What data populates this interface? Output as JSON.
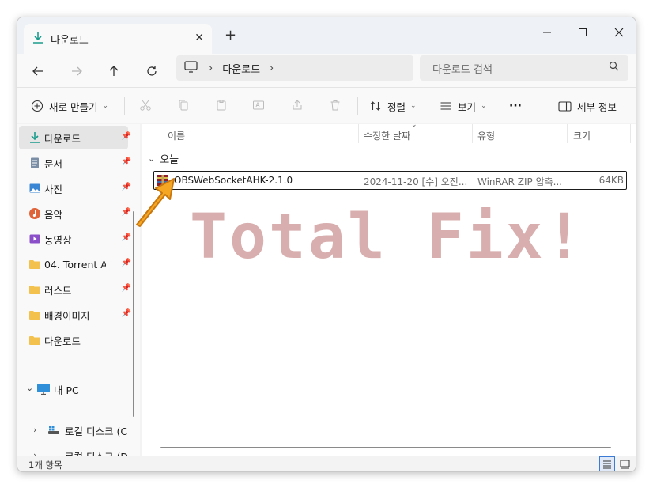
{
  "window": {
    "tab_title": "다운로드",
    "tab_close": "✕",
    "new_tab": "+"
  },
  "address_bar": {
    "breadcrumb": "다운로드",
    "search_placeholder": "다운로드 검색"
  },
  "command_bar": {
    "new_label": "새로 만들기",
    "sort_label": "정렬",
    "view_label": "보기",
    "more_label": "···",
    "details_label": "세부 정보"
  },
  "sidebar": {
    "items": [
      {
        "label": "다운로드",
        "icon": "download-icon",
        "pinned": true
      },
      {
        "label": "문서",
        "icon": "document-icon",
        "pinned": true
      },
      {
        "label": "사진",
        "icon": "picture-icon",
        "pinned": true
      },
      {
        "label": "음악",
        "icon": "music-icon",
        "pinned": true
      },
      {
        "label": "동영상",
        "icon": "video-icon",
        "pinned": true
      },
      {
        "label": "04. Torrent A",
        "icon": "folder-icon",
        "pinned": true
      },
      {
        "label": "러스트",
        "icon": "folder-icon",
        "pinned": true
      },
      {
        "label": "배경이미지",
        "icon": "folder-icon",
        "pinned": true
      },
      {
        "label": "다운로드",
        "icon": "folder-icon",
        "pinned": false
      }
    ],
    "this_pc": "내 PC",
    "drives": [
      "로컬 디스크 (C",
      "로컬 디스크 (D"
    ]
  },
  "columns": {
    "name": "이름",
    "modified": "수정한 날짜",
    "type": "유형",
    "size": "크기"
  },
  "group": {
    "label": "오늘"
  },
  "files": [
    {
      "name": "OBSWebSocketAHK-2.1.0",
      "modified": "2024-11-20 [수] 오전...",
      "type": "WinRAR ZIP 압축...",
      "size": "64KB"
    }
  ],
  "watermark": "Total Fix!",
  "status": {
    "item_count": "1개 항목"
  },
  "colors": {
    "accent": "#0067c0",
    "arrow": "#f5a623",
    "watermark": "#c08080"
  }
}
